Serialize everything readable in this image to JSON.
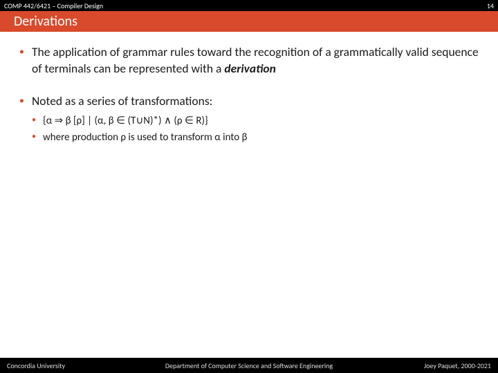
{
  "topbar": {
    "left": "COMP 442/6421 – Compiler Design",
    "right": "14"
  },
  "title": "Derivations",
  "bullets": {
    "b1_pre": "The application of grammar rules toward the recognition of a grammatically valid sequence of terminals can be represented with a ",
    "b1_kw": "derivation",
    "b2": "Noted as a series of transformations:",
    "b2s1": "{α ⇒ β [ρ] | (α, β ∈ (T∪N)*) ∧ (ρ ∈ R)}",
    "b2s2": "where production ρ is used to transform α into β"
  },
  "footer": {
    "left": "Concordia University",
    "mid": "Department of Computer Science and Software Engineering",
    "right": "Joey Paquet, 2000-2021"
  }
}
